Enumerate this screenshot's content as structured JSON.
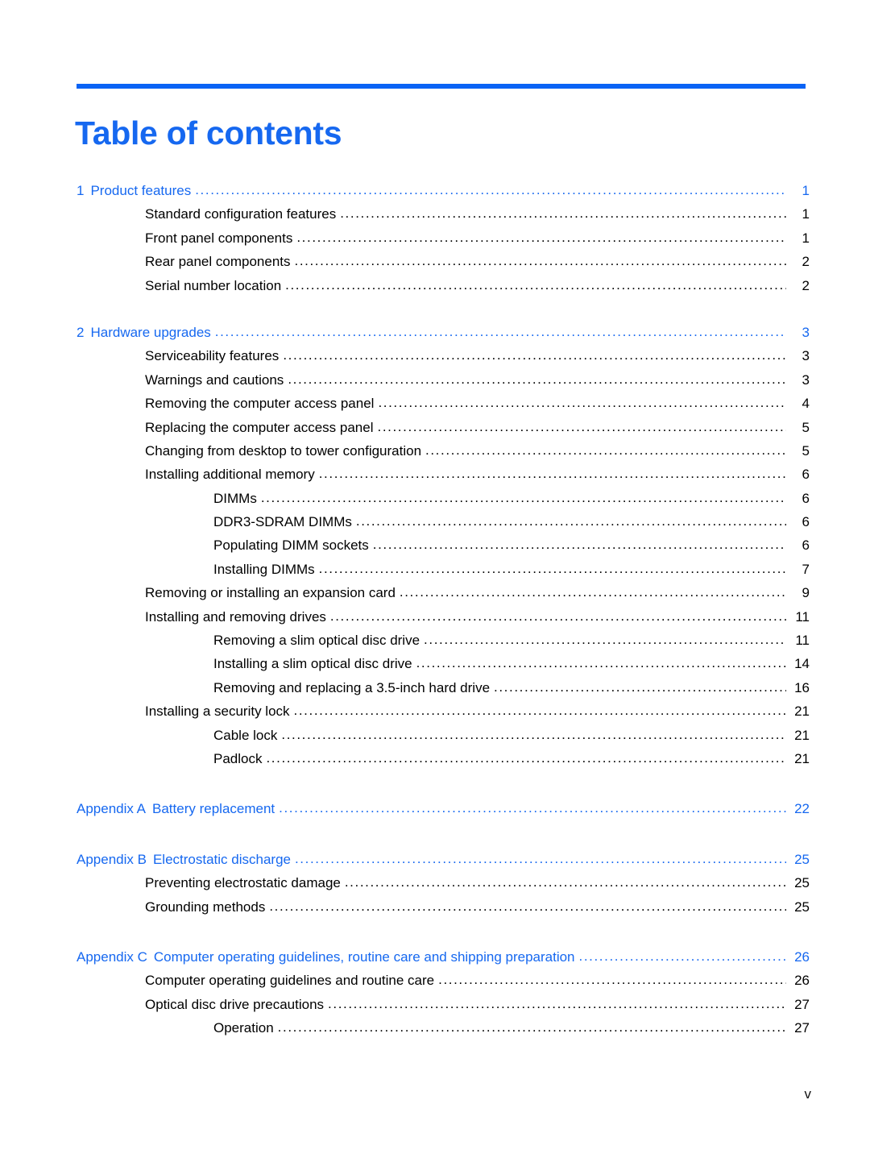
{
  "document": {
    "title": "Table of contents",
    "footer_page_label": "v",
    "accent_color": "#1668f0",
    "rule_color": "#0a63f5",
    "body_text_color": "#000000"
  },
  "toc": {
    "entries": [
      {
        "level": 1,
        "number": "1",
        "label": "Product features",
        "page": "1"
      },
      {
        "level": 2,
        "number": "",
        "label": "Standard configuration features",
        "page": "1"
      },
      {
        "level": 2,
        "number": "",
        "label": "Front panel components",
        "page": "1"
      },
      {
        "level": 2,
        "number": "",
        "label": "Rear panel components",
        "page": "2"
      },
      {
        "level": 2,
        "number": "",
        "label": "Serial number location",
        "page": "2"
      },
      {
        "level": 1,
        "number": "2",
        "label": "Hardware upgrades",
        "page": "3"
      },
      {
        "level": 2,
        "number": "",
        "label": "Serviceability features",
        "page": "3"
      },
      {
        "level": 2,
        "number": "",
        "label": "Warnings and cautions",
        "page": "3"
      },
      {
        "level": 2,
        "number": "",
        "label": "Removing the computer access panel",
        "page": "4"
      },
      {
        "level": 2,
        "number": "",
        "label": "Replacing the computer access panel",
        "page": "5"
      },
      {
        "level": 2,
        "number": "",
        "label": "Changing from desktop to tower configuration",
        "page": "5"
      },
      {
        "level": 2,
        "number": "",
        "label": "Installing additional memory",
        "page": "6"
      },
      {
        "level": 3,
        "number": "",
        "label": "DIMMs",
        "page": "6"
      },
      {
        "level": 3,
        "number": "",
        "label": "DDR3-SDRAM DIMMs",
        "page": "6"
      },
      {
        "level": 3,
        "number": "",
        "label": "Populating DIMM sockets",
        "page": "6"
      },
      {
        "level": 3,
        "number": "",
        "label": "Installing DIMMs",
        "page": "7"
      },
      {
        "level": 2,
        "number": "",
        "label": "Removing or installing an expansion card",
        "page": "9"
      },
      {
        "level": 2,
        "number": "",
        "label": "Installing and removing drives",
        "page": "11"
      },
      {
        "level": 3,
        "number": "",
        "label": "Removing a slim optical disc drive",
        "page": "11"
      },
      {
        "level": 3,
        "number": "",
        "label": "Installing a slim optical disc drive",
        "page": "14"
      },
      {
        "level": 3,
        "number": "",
        "label": "Removing and replacing a 3.5-inch hard drive",
        "page": "16"
      },
      {
        "level": 2,
        "number": "",
        "label": "Installing a security lock",
        "page": "21"
      },
      {
        "level": 3,
        "number": "",
        "label": "Cable lock",
        "page": "21"
      },
      {
        "level": 3,
        "number": "",
        "label": "Padlock",
        "page": "21"
      },
      {
        "level": 1,
        "number": "Appendix A",
        "label": "Battery replacement",
        "page": "22"
      },
      {
        "level": 1,
        "number": "Appendix B",
        "label": "Electrostatic discharge",
        "page": "25"
      },
      {
        "level": 2,
        "number": "",
        "label": "Preventing electrostatic damage",
        "page": "25"
      },
      {
        "level": 2,
        "number": "",
        "label": "Grounding methods",
        "page": "25"
      },
      {
        "level": 1,
        "number": "Appendix C",
        "label": "Computer operating guidelines, routine care and shipping preparation",
        "page": "26"
      },
      {
        "level": 2,
        "number": "",
        "label": "Computer operating guidelines and routine care",
        "page": "26"
      },
      {
        "level": 2,
        "number": "",
        "label": "Optical disc drive precautions",
        "page": "27"
      },
      {
        "level": 3,
        "number": "",
        "label": "Operation",
        "page": "27"
      }
    ],
    "leader_dots": "........................................................................................................................................................................................................................"
  }
}
